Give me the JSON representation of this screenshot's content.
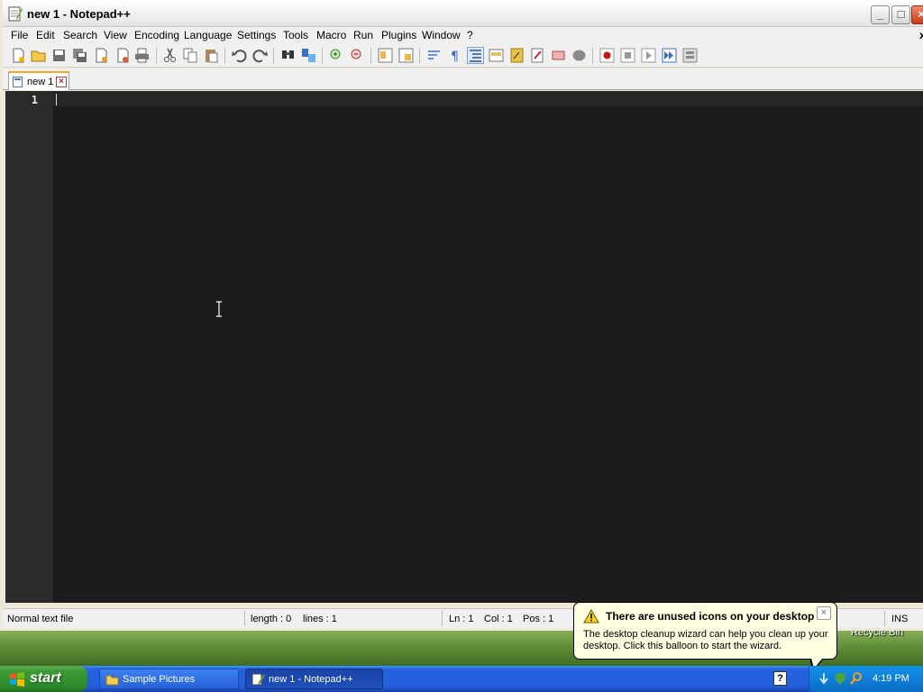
{
  "window": {
    "title": "new 1 - Notepad++"
  },
  "menu": {
    "items": [
      "File",
      "Edit",
      "Search",
      "View",
      "Encoding",
      "Language",
      "Settings",
      "Tools",
      "Macro",
      "Run",
      "Plugins",
      "Window",
      "?"
    ],
    "close_glyph": "x"
  },
  "tabs": [
    {
      "label": "new 1"
    }
  ],
  "editor": {
    "line_number": "1"
  },
  "statusbar": {
    "file_type": "Normal text file",
    "length": "length : 0",
    "lines": "lines : 1",
    "ln": "Ln : 1",
    "col": "Col : 1",
    "pos": "Pos : 1",
    "mode": "INS"
  },
  "balloon": {
    "title": "There are unused icons on your desktop",
    "body": "The desktop cleanup wizard can help you clean up your desktop. Click this balloon to start the wizard."
  },
  "desktop": {
    "recycle_bin_label": "Recycle Bin"
  },
  "taskbar": {
    "start_label": "start",
    "tasks": [
      "Sample Pictures",
      "new 1 - Notepad++"
    ],
    "clock": "4:19 PM"
  },
  "colors": {
    "editor_bg": "#1c1c1c",
    "taskbar_blue": "#245edb",
    "start_green": "#3c9b36",
    "balloon_bg": "#ffffe1"
  }
}
